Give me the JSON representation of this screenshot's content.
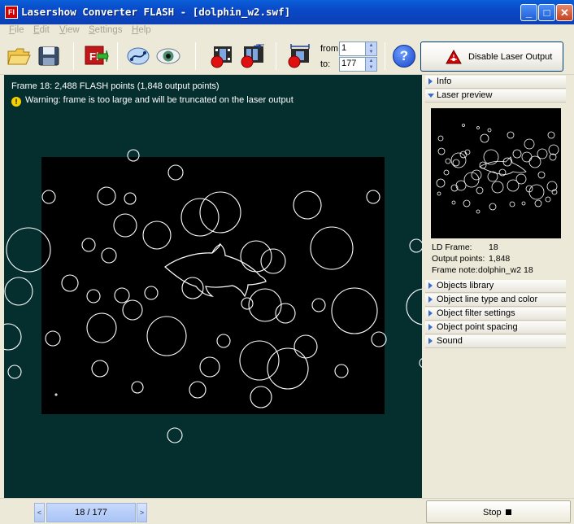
{
  "window": {
    "app_icon_text": "Fl",
    "title": "Lasershow Converter FLASH - [dolphin_w2.swf]",
    "minimize_glyph": "_",
    "maximize_glyph": "□",
    "close_glyph": "✕"
  },
  "menu": [
    {
      "key": "F",
      "rest": "ile"
    },
    {
      "key": "E",
      "rest": "dit"
    },
    {
      "key": "V",
      "rest": "iew"
    },
    {
      "key": "S",
      "rest": "ettings"
    },
    {
      "key": "H",
      "rest": "elp"
    }
  ],
  "toolbar": {
    "icons": [
      "open-folder-icon",
      "save-disk-icon",
      "flash-import-icon",
      "preview-path-icon",
      "eye-icon",
      "record-frame-icon",
      "record-all-frames-icon",
      "record-range-icon",
      "help-icon",
      "laser-warning-icon"
    ],
    "from_label": "from:",
    "from_value": "1",
    "to_label": "to:",
    "to_value": "177",
    "help_glyph": "?",
    "laser_button_label": "Disable Laser Output"
  },
  "canvas": {
    "frame_info": "Frame 18:   2,488 FLASH points    (1,848 output points)",
    "warning_text": "Warning: frame is too large and will be truncated on the laser output",
    "warning_glyph": "!"
  },
  "sidepanel": {
    "info_label": "Info",
    "laser_preview_label": "Laser preview",
    "ld_frame_key": "LD Frame:",
    "ld_frame_value": "18",
    "output_points_key": "Output points:",
    "output_points_value": "1,848",
    "frame_note_key": "Frame note:",
    "frame_note_value": "dolphin_w2 18",
    "sections": [
      "Objects library",
      "Object line type and color",
      "Object filter settings",
      "Object point spacing",
      "Sound"
    ]
  },
  "statusbar": {
    "prev_glyph": "<",
    "next_glyph": ">",
    "frame_counter": "18 / 177",
    "stop_label": "Stop"
  },
  "colors": {
    "canvas_bg": "#052f2e",
    "frame_bg": "#000000",
    "stroke": "#ffffff",
    "title_bar": "#0a49c8",
    "laser_icon_red": "#d40000"
  }
}
